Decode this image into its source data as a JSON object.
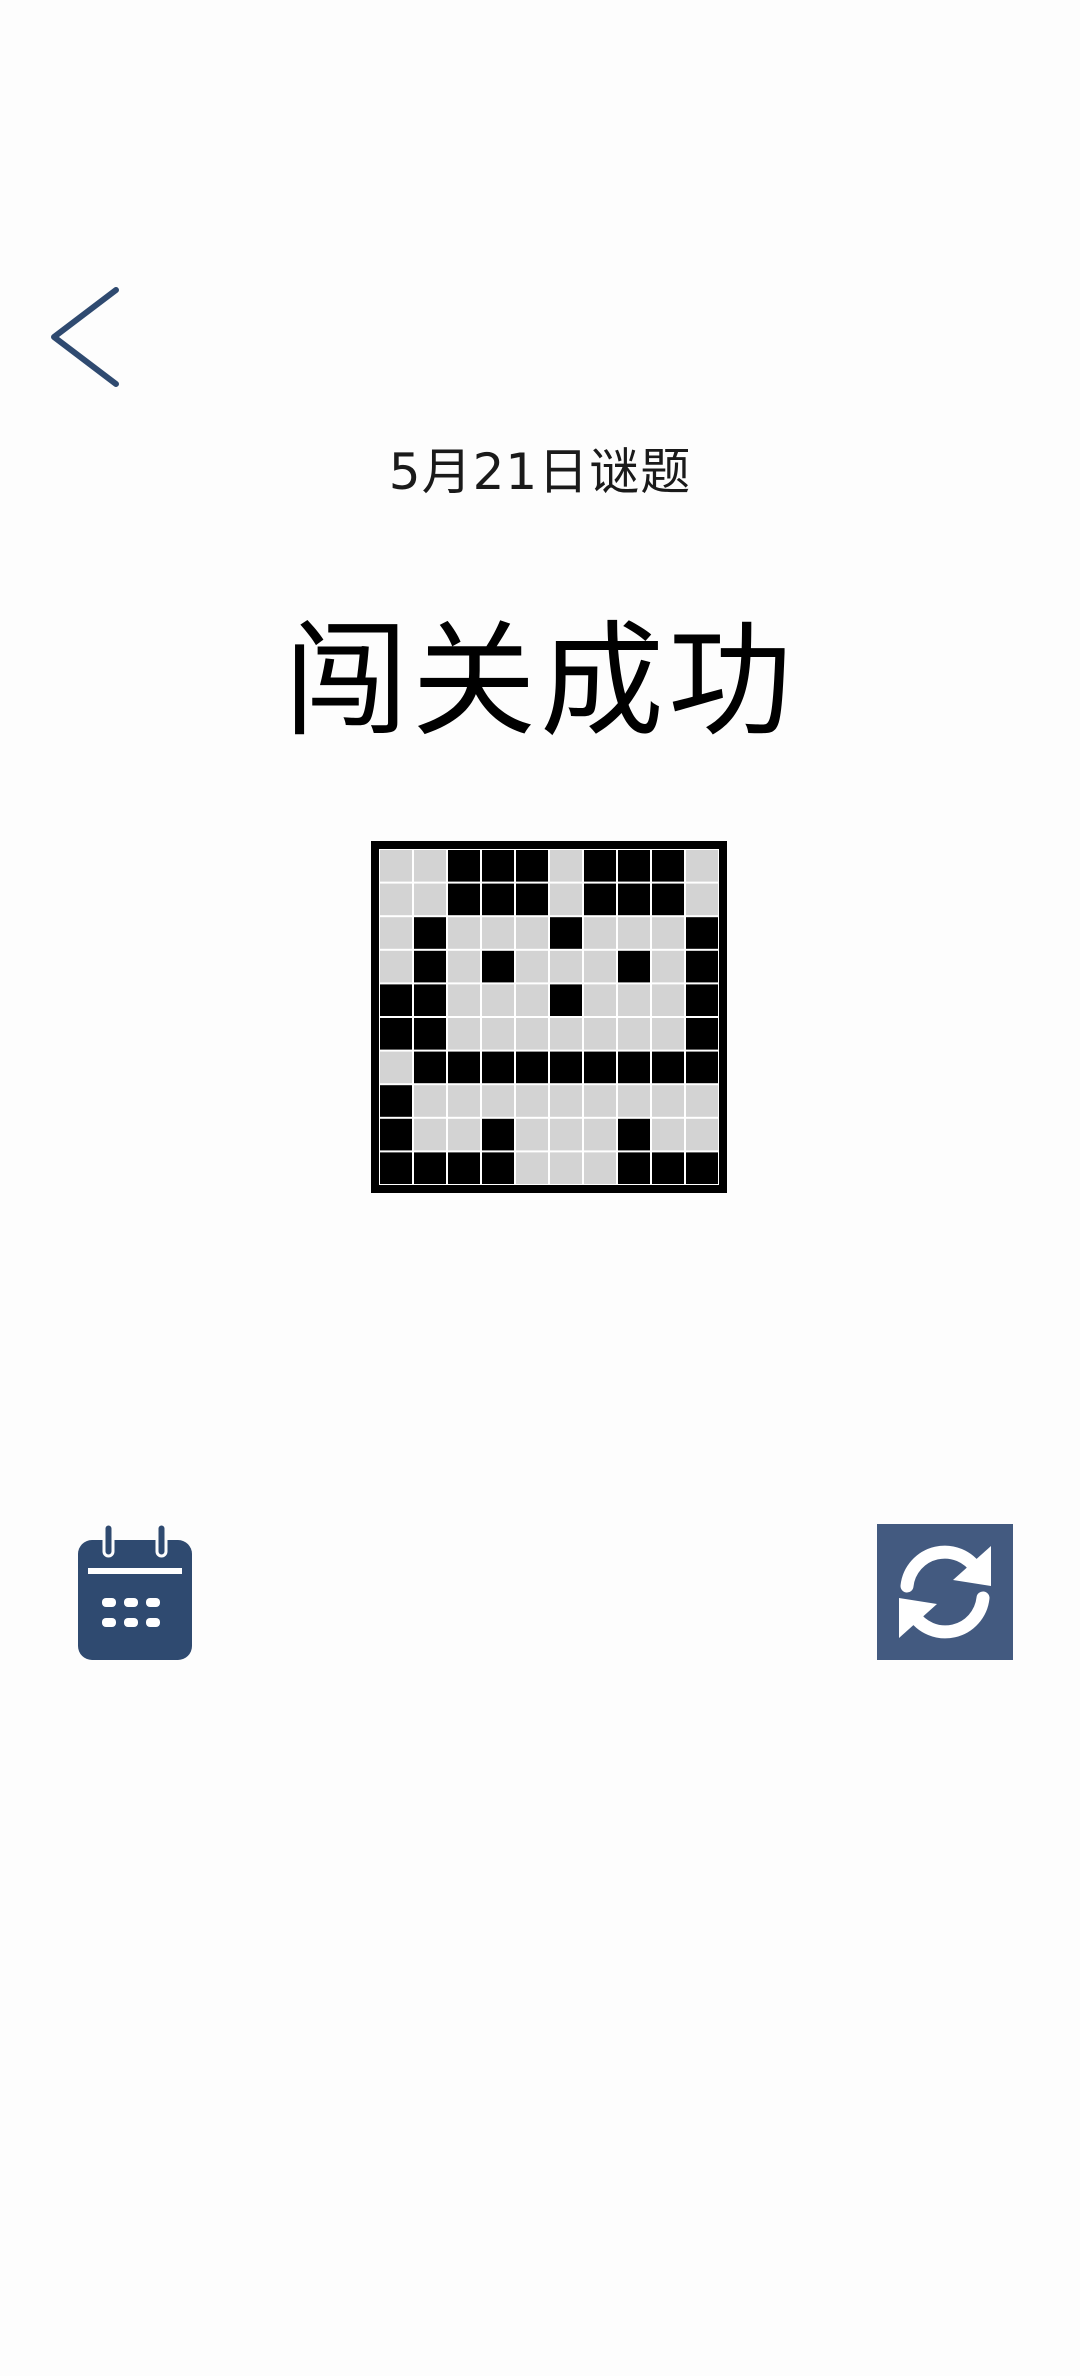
{
  "header": {
    "back_icon": "chevron-left-icon",
    "puzzle_date": "5月21日谜题",
    "result_title": "闯关成功"
  },
  "puzzle": {
    "rows": 10,
    "cols": 10,
    "filled_color": "#000000",
    "empty_color": "#d3d3d3",
    "frame_color": "#000000",
    "cells": [
      [
        0,
        0,
        1,
        1,
        1,
        0,
        1,
        1,
        1,
        0
      ],
      [
        0,
        0,
        1,
        1,
        1,
        0,
        1,
        1,
        1,
        0
      ],
      [
        0,
        1,
        0,
        0,
        0,
        1,
        0,
        0,
        0,
        1
      ],
      [
        0,
        1,
        0,
        1,
        0,
        0,
        0,
        1,
        0,
        1
      ],
      [
        1,
        1,
        0,
        0,
        0,
        1,
        0,
        0,
        0,
        1
      ],
      [
        1,
        1,
        0,
        0,
        0,
        0,
        0,
        0,
        0,
        1
      ],
      [
        0,
        1,
        1,
        1,
        1,
        1,
        1,
        1,
        1,
        1
      ],
      [
        1,
        0,
        0,
        0,
        0,
        0,
        0,
        0,
        0,
        0
      ],
      [
        1,
        0,
        0,
        1,
        0,
        0,
        0,
        1,
        0,
        0
      ],
      [
        1,
        1,
        1,
        1,
        0,
        0,
        0,
        1,
        1,
        1
      ]
    ]
  },
  "actions": {
    "calendar_icon": "calendar-icon",
    "refresh_icon": "refresh-icon",
    "accent_color": "#2f4a70",
    "refresh_bg_color": "#435a80"
  }
}
